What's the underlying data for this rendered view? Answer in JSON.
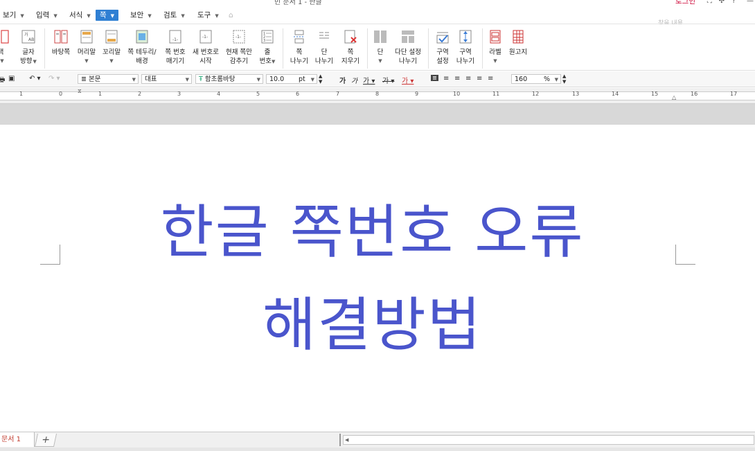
{
  "window": {
    "title": "빈 문서 1 - 한글",
    "login": "로그인",
    "search_placeholder": "찾을 내용"
  },
  "menu": [
    {
      "label": "보기"
    },
    {
      "label": "입력"
    },
    {
      "label": "서식"
    },
    {
      "label": "쪽",
      "active": true
    },
    {
      "label": "보안"
    },
    {
      "label": "검토"
    },
    {
      "label": "도구"
    }
  ],
  "ribbon": {
    "text_direction": "글자\n방향",
    "background_page": "바탕쪽",
    "header": "머리말",
    "footer": "꼬리말",
    "page_border": "쪽 테두리/\n배경",
    "page_number": "쪽 번호\n매기기",
    "new_number": "새 번호로\n시작",
    "hide_current": "현재 쪽만\n감추기",
    "line_number": "줄\n번호",
    "page_break": "쪽\n나누기",
    "column_break": "단\n나누기",
    "page_delete": "쪽\n지우기",
    "column": "단",
    "multi_column": "다단 설정\n나누기",
    "section_setting": "구역\n설정",
    "section_break": "구역\n나누기",
    "label": "라벨",
    "manuscript": "원고지"
  },
  "format_bar": {
    "style": "본문",
    "language": "대표",
    "font": "함초롬바탕",
    "font_size": "10.0",
    "unit": "pt",
    "zoom": "160",
    "zoom_unit": "%"
  },
  "ruler": {
    "labels": [
      "1",
      "0",
      "1",
      "2",
      "3",
      "4",
      "5",
      "6",
      "7",
      "8",
      "9",
      "10",
      "11",
      "12",
      "13",
      "14",
      "15",
      "16",
      "17"
    ]
  },
  "document": {
    "line1": "한글 쪽번호 오류",
    "line2": "해결방법"
  },
  "tabs": {
    "doc_tab": "문서 1",
    "add": "+"
  },
  "colors": {
    "accent": "#2f7fd3",
    "heading": "#4a55cc"
  }
}
